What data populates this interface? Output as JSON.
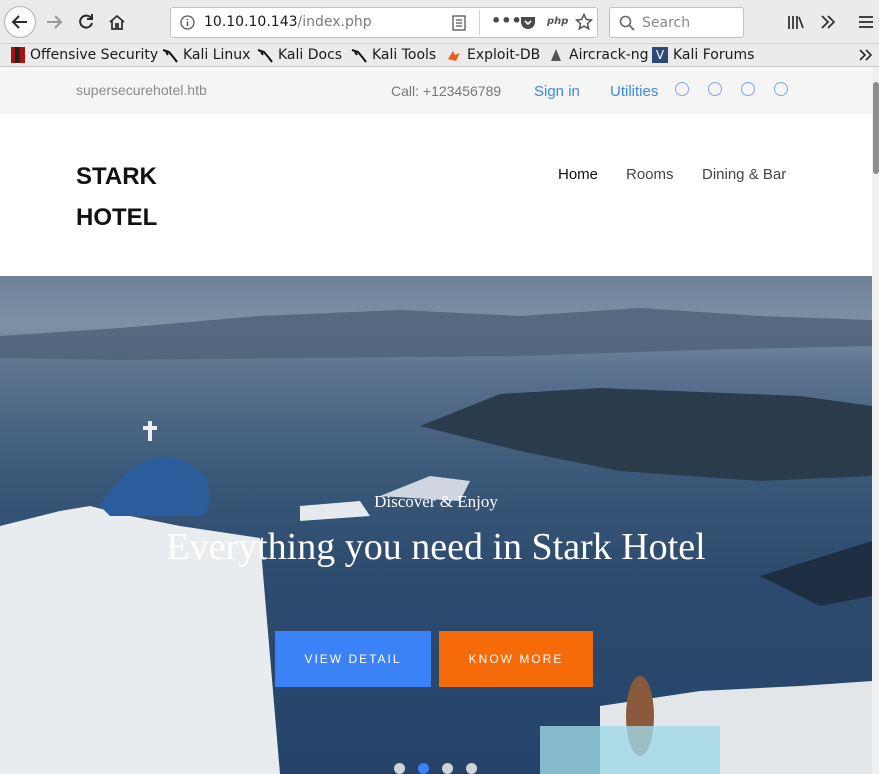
{
  "browser": {
    "url_host": "10.10.10.143",
    "url_path": "/index.php",
    "search_placeholder": "Search",
    "bookmarks": [
      {
        "label": "Offensive Security",
        "icon": "offsec-icon"
      },
      {
        "label": "Kali Linux",
        "icon": "kali-dragon-icon"
      },
      {
        "label": "Kali Docs",
        "icon": "kali-dragon-icon"
      },
      {
        "label": "Kali Tools",
        "icon": "kali-dragon-icon"
      },
      {
        "label": "Exploit-DB",
        "icon": "exploitdb-icon"
      },
      {
        "label": "Aircrack-ng",
        "icon": "aircrack-icon"
      },
      {
        "label": "Kali Forums",
        "icon": "kali-forums-icon"
      }
    ]
  },
  "topbar": {
    "domain": "supersecurehotel.htb",
    "call": "Call: +123456789",
    "sign_in": "Sign in",
    "utilities": "Utilities",
    "social_icons": [
      "twitter-icon",
      "facebook-icon",
      "linkedin-icon",
      "dribbble-icon"
    ]
  },
  "header": {
    "logo_line1": "STARK",
    "logo_line2": "HOTEL",
    "menu": [
      "Home",
      "Rooms",
      "Dining & Bar"
    ],
    "active_menu": "Home"
  },
  "hero": {
    "tagline": "Discover & Enjoy",
    "title": "Everything you need in Stark Hotel",
    "button_primary": "VIEW DETAIL",
    "button_secondary": "KNOW MORE",
    "slide_count": 4,
    "active_slide": 2
  },
  "colors": {
    "accent_blue": "#3b82f6",
    "accent_orange": "#f56b0a",
    "link_blue": "#3b8ae6"
  }
}
